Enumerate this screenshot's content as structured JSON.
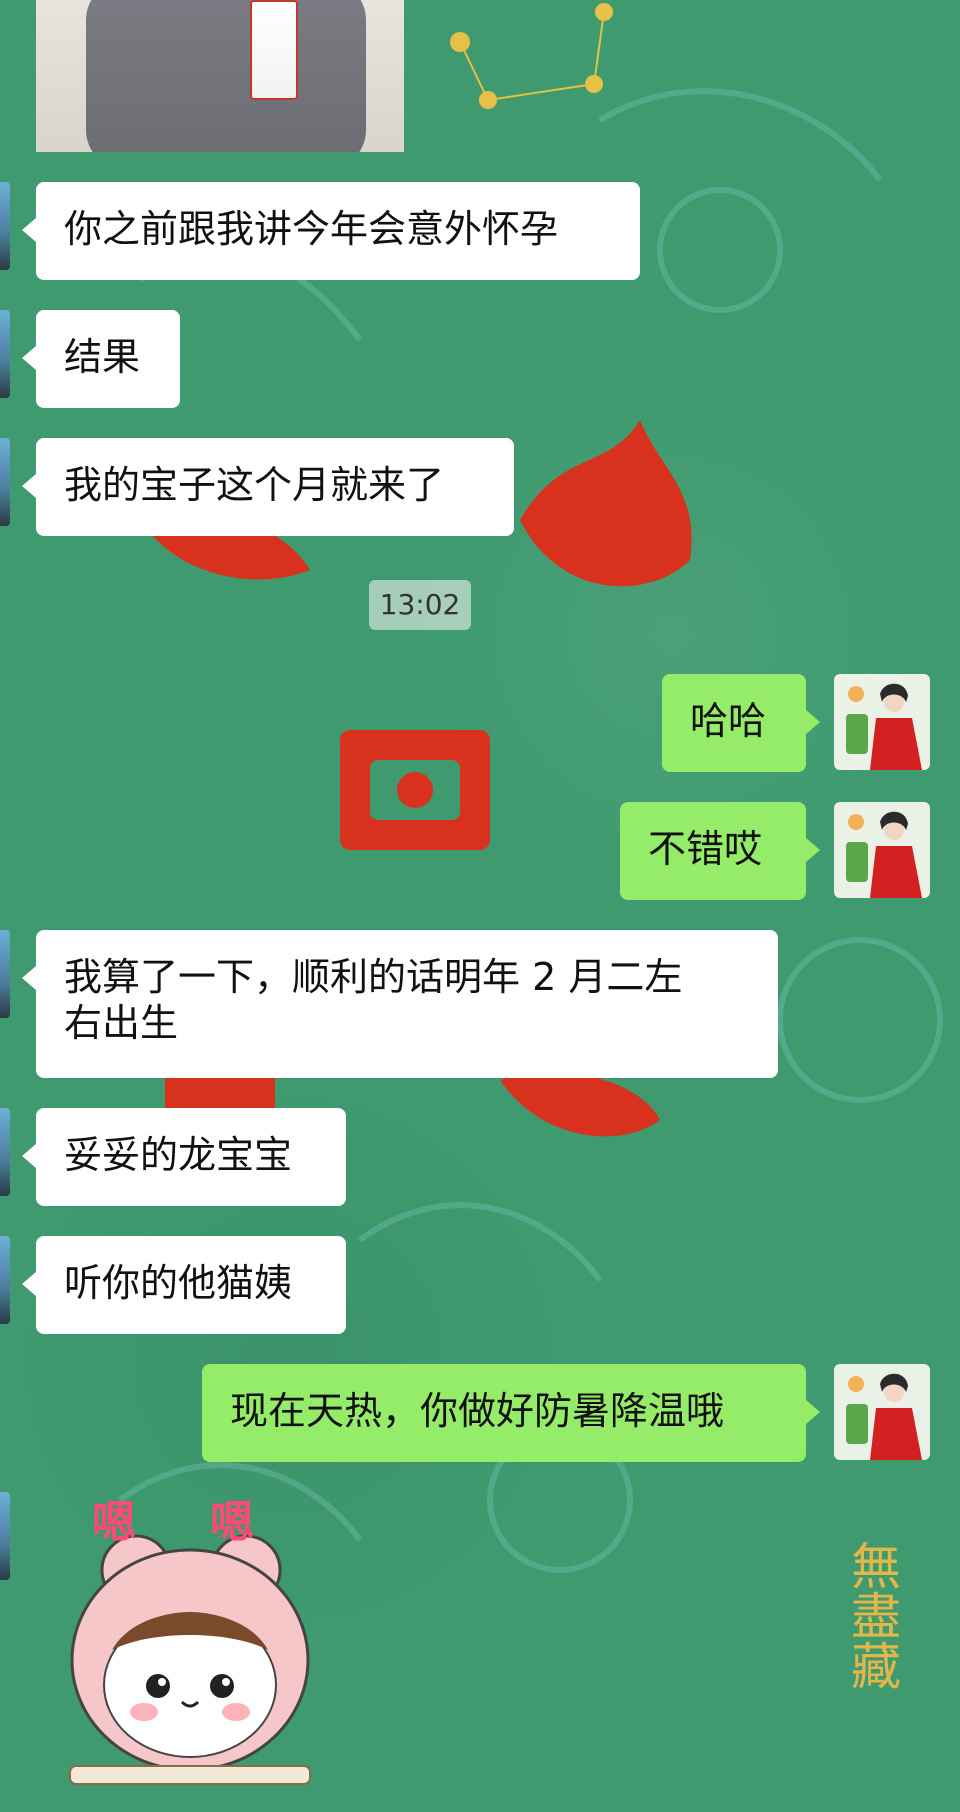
{
  "timestamp": "13:02",
  "messages": [
    {
      "side": "in",
      "text": "你之前跟我讲今年会意外怀孕"
    },
    {
      "side": "in",
      "text": "结果"
    },
    {
      "side": "in",
      "text": "我的宝子这个月就来了"
    },
    {
      "side": "out",
      "text": "哈哈"
    },
    {
      "side": "out",
      "text": "不错哎"
    },
    {
      "side": "in",
      "text": "我算了一下，顺利的话明年 2 月二左\n右出生"
    },
    {
      "side": "in",
      "text": "妥妥的龙宝宝"
    },
    {
      "side": "in",
      "text": "听你的他猫姨"
    },
    {
      "side": "out",
      "text": "现在天热，你做好防暑降温哦"
    }
  ],
  "sticker": {
    "text1": "嗯",
    "text2": "嗯",
    "icon": "pink-bear-girl-sticker"
  },
  "background": {
    "color": "#3f9a6f",
    "watermark": "無盡藏",
    "pattern": "red-seal-characters"
  },
  "colors": {
    "in_bubble": "#ffffff",
    "out_bubble": "#95ec69"
  }
}
